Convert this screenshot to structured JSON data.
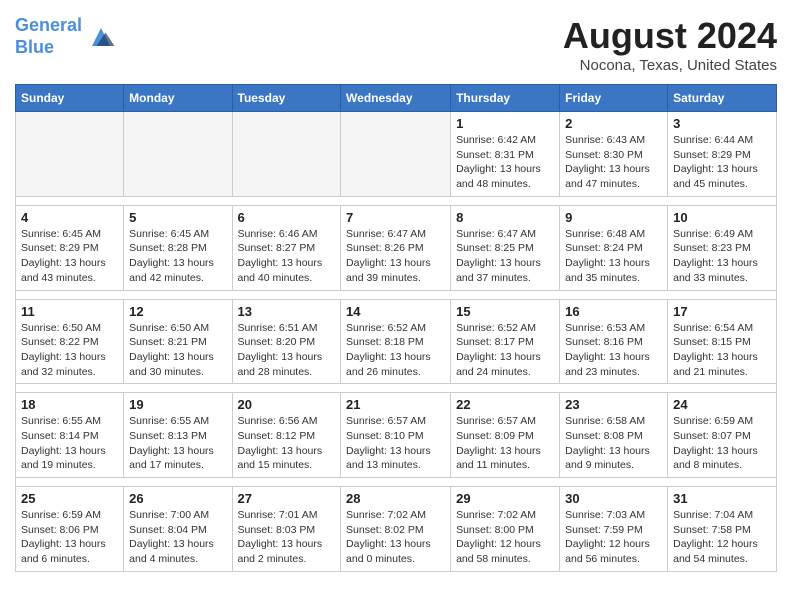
{
  "header": {
    "logo_line1": "General",
    "logo_line2": "Blue",
    "month_year": "August 2024",
    "location": "Nocona, Texas, United States"
  },
  "days_of_week": [
    "Sunday",
    "Monday",
    "Tuesday",
    "Wednesday",
    "Thursday",
    "Friday",
    "Saturday"
  ],
  "weeks": [
    [
      {
        "day": "",
        "empty": true
      },
      {
        "day": "",
        "empty": true
      },
      {
        "day": "",
        "empty": true
      },
      {
        "day": "",
        "empty": true
      },
      {
        "day": "1",
        "sunrise": "6:42 AM",
        "sunset": "8:31 PM",
        "daylight": "13 hours and 48 minutes."
      },
      {
        "day": "2",
        "sunrise": "6:43 AM",
        "sunset": "8:30 PM",
        "daylight": "13 hours and 47 minutes."
      },
      {
        "day": "3",
        "sunrise": "6:44 AM",
        "sunset": "8:29 PM",
        "daylight": "13 hours and 45 minutes."
      }
    ],
    [
      {
        "day": "4",
        "sunrise": "6:45 AM",
        "sunset": "8:29 PM",
        "daylight": "13 hours and 43 minutes."
      },
      {
        "day": "5",
        "sunrise": "6:45 AM",
        "sunset": "8:28 PM",
        "daylight": "13 hours and 42 minutes."
      },
      {
        "day": "6",
        "sunrise": "6:46 AM",
        "sunset": "8:27 PM",
        "daylight": "13 hours and 40 minutes."
      },
      {
        "day": "7",
        "sunrise": "6:47 AM",
        "sunset": "8:26 PM",
        "daylight": "13 hours and 39 minutes."
      },
      {
        "day": "8",
        "sunrise": "6:47 AM",
        "sunset": "8:25 PM",
        "daylight": "13 hours and 37 minutes."
      },
      {
        "day": "9",
        "sunrise": "6:48 AM",
        "sunset": "8:24 PM",
        "daylight": "13 hours and 35 minutes."
      },
      {
        "day": "10",
        "sunrise": "6:49 AM",
        "sunset": "8:23 PM",
        "daylight": "13 hours and 33 minutes."
      }
    ],
    [
      {
        "day": "11",
        "sunrise": "6:50 AM",
        "sunset": "8:22 PM",
        "daylight": "13 hours and 32 minutes."
      },
      {
        "day": "12",
        "sunrise": "6:50 AM",
        "sunset": "8:21 PM",
        "daylight": "13 hours and 30 minutes."
      },
      {
        "day": "13",
        "sunrise": "6:51 AM",
        "sunset": "8:20 PM",
        "daylight": "13 hours and 28 minutes."
      },
      {
        "day": "14",
        "sunrise": "6:52 AM",
        "sunset": "8:18 PM",
        "daylight": "13 hours and 26 minutes."
      },
      {
        "day": "15",
        "sunrise": "6:52 AM",
        "sunset": "8:17 PM",
        "daylight": "13 hours and 24 minutes."
      },
      {
        "day": "16",
        "sunrise": "6:53 AM",
        "sunset": "8:16 PM",
        "daylight": "13 hours and 23 minutes."
      },
      {
        "day": "17",
        "sunrise": "6:54 AM",
        "sunset": "8:15 PM",
        "daylight": "13 hours and 21 minutes."
      }
    ],
    [
      {
        "day": "18",
        "sunrise": "6:55 AM",
        "sunset": "8:14 PM",
        "daylight": "13 hours and 19 minutes."
      },
      {
        "day": "19",
        "sunrise": "6:55 AM",
        "sunset": "8:13 PM",
        "daylight": "13 hours and 17 minutes."
      },
      {
        "day": "20",
        "sunrise": "6:56 AM",
        "sunset": "8:12 PM",
        "daylight": "13 hours and 15 minutes."
      },
      {
        "day": "21",
        "sunrise": "6:57 AM",
        "sunset": "8:10 PM",
        "daylight": "13 hours and 13 minutes."
      },
      {
        "day": "22",
        "sunrise": "6:57 AM",
        "sunset": "8:09 PM",
        "daylight": "13 hours and 11 minutes."
      },
      {
        "day": "23",
        "sunrise": "6:58 AM",
        "sunset": "8:08 PM",
        "daylight": "13 hours and 9 minutes."
      },
      {
        "day": "24",
        "sunrise": "6:59 AM",
        "sunset": "8:07 PM",
        "daylight": "13 hours and 8 minutes."
      }
    ],
    [
      {
        "day": "25",
        "sunrise": "6:59 AM",
        "sunset": "8:06 PM",
        "daylight": "13 hours and 6 minutes."
      },
      {
        "day": "26",
        "sunrise": "7:00 AM",
        "sunset": "8:04 PM",
        "daylight": "13 hours and 4 minutes."
      },
      {
        "day": "27",
        "sunrise": "7:01 AM",
        "sunset": "8:03 PM",
        "daylight": "13 hours and 2 minutes."
      },
      {
        "day": "28",
        "sunrise": "7:02 AM",
        "sunset": "8:02 PM",
        "daylight": "13 hours and 0 minutes."
      },
      {
        "day": "29",
        "sunrise": "7:02 AM",
        "sunset": "8:00 PM",
        "daylight": "12 hours and 58 minutes."
      },
      {
        "day": "30",
        "sunrise": "7:03 AM",
        "sunset": "7:59 PM",
        "daylight": "12 hours and 56 minutes."
      },
      {
        "day": "31",
        "sunrise": "7:04 AM",
        "sunset": "7:58 PM",
        "daylight": "12 hours and 54 minutes."
      }
    ]
  ],
  "labels": {
    "sunrise": "Sunrise:",
    "sunset": "Sunset:",
    "daylight": "Daylight:"
  }
}
